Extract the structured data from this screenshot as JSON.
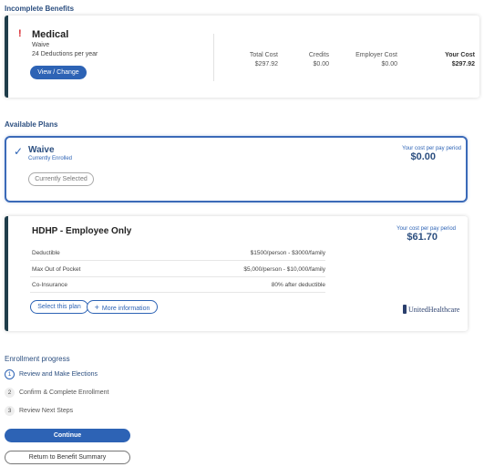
{
  "incomplete": {
    "section_title": "Incomplete Benefits",
    "plan_title": "Medical",
    "plan_sub": "Waive",
    "deductions": "24 Deductions per year",
    "view_change_label": "View / Change",
    "costs": [
      {
        "label": "Total Cost",
        "value": "$297.92"
      },
      {
        "label": "Credits",
        "value": "$0.00"
      },
      {
        "label": "Employer Cost",
        "value": "$0.00"
      },
      {
        "label": "Your Cost",
        "value": "$297.92"
      }
    ]
  },
  "available": {
    "section_title": "Available Plans",
    "waive": {
      "title": "Waive",
      "status": "Currently Enrolled",
      "selected_label": "Currently Selected",
      "pp_label": "Your cost per pay period",
      "pp_value": "$0.00"
    },
    "hdhp": {
      "title": "HDHP - Employee Only",
      "pp_label": "Your cost per pay period",
      "pp_value": "$61.70",
      "rows": [
        {
          "label": "Deductible",
          "value": "$1500/person - $3000/family"
        },
        {
          "label": "Max Out of Pocket",
          "value": "$5,000/person - $10,000/family"
        },
        {
          "label": "Co-Insurance",
          "value": "80% after deductible"
        }
      ],
      "select_label": "Select this plan",
      "more_info_label": "More information",
      "carrier": "UnitedHealthcare"
    }
  },
  "progress": {
    "title": "Enrollment progress",
    "steps": [
      {
        "num": "1",
        "label": "Review and Make Elections"
      },
      {
        "num": "2",
        "label": "Confirm & Complete Enrollment"
      },
      {
        "num": "3",
        "label": "Review Next Steps"
      }
    ],
    "continue_label": "Continue",
    "return_label": "Return to Benefit Summary"
  },
  "colors": {
    "accent": "#2d63b5",
    "heading": "#2c4f80",
    "alert": "#d8272e",
    "card_bar": "#1f3d4a"
  },
  "icons": {
    "alert": "exclamation-icon",
    "check": "check-icon",
    "plus": "plus-icon",
    "carrier_logo": "unitedhealthcare-logo"
  }
}
